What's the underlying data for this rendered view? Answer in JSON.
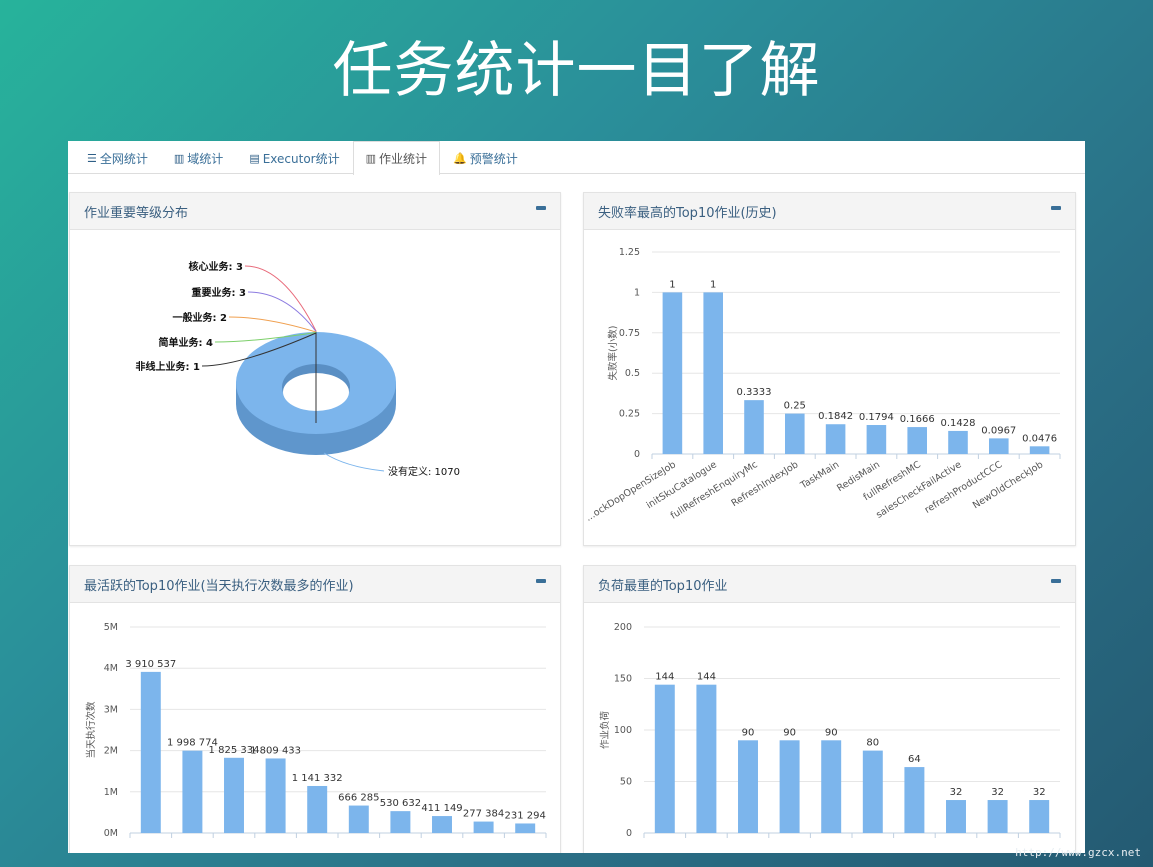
{
  "slide_title": "任务统计一目了解",
  "tabs": [
    {
      "icon": "list-icon",
      "glyph": "☰",
      "label": "全网统计",
      "active": false
    },
    {
      "icon": "bar-chart-icon",
      "glyph": "▥",
      "label": "域统计",
      "active": false
    },
    {
      "icon": "server-icon",
      "glyph": "▤",
      "label": "Executor统计",
      "active": false
    },
    {
      "icon": "column-chart-icon",
      "glyph": "▥",
      "label": "作业统计",
      "active": true
    },
    {
      "icon": "bell-icon",
      "glyph": "🔔",
      "label": "预警统计",
      "active": false
    }
  ],
  "panels": {
    "pie": {
      "title": "作业重要等级分布"
    },
    "fail": {
      "title": "失败率最高的Top10作业(历史)"
    },
    "active": {
      "title": "最活跃的Top10作业(当天执行次数最多的作业)"
    },
    "load": {
      "title": "负荷最重的Top10作业"
    }
  },
  "watermark": "http://www.gzcx.net",
  "colors": {
    "bar": "#7cb5ec",
    "accent": "#3a6f98",
    "tab_text": "#3a6f98"
  },
  "chart_data": [
    {
      "type": "pie",
      "style": "3d-donut",
      "slices": [
        {
          "label": "核心业务: 3",
          "value": 3,
          "line_color": "#e86a7a"
        },
        {
          "label": "重要业务: 3",
          "value": 3,
          "line_color": "#8c7be0"
        },
        {
          "label": "一般业务: 2",
          "value": 2,
          "line_color": "#f0a050"
        },
        {
          "label": "简单业务: 4",
          "value": 4,
          "line_color": "#7ccf6a"
        },
        {
          "label": "非线上业务: 1",
          "value": 1,
          "line_color": "#333333"
        },
        {
          "label": "没有定义: 1070",
          "value": 1070,
          "line_color": "#7cb5ec"
        }
      ]
    },
    {
      "type": "bar",
      "ylabel": "失败率(小数)",
      "ylim": [
        0,
        1.25
      ],
      "yticks": [
        "0",
        "0.25",
        "0.5",
        "0.75",
        "1",
        "1.25"
      ],
      "categories": [
        "...ockDopOpenSizeJob",
        "initSkuCatalogue",
        "fullRefreshEnquiryMc",
        "RefreshIndexJob",
        "TaskMain",
        "RedisMain",
        "fullRefreshMC",
        "salesCheckFailActive",
        "refreshProductCCC",
        "NewOldCheckJob"
      ],
      "values": [
        1,
        1,
        0.3333,
        0.25,
        0.1842,
        0.1794,
        0.1666,
        0.1428,
        0.0967,
        0.0476
      ],
      "labels": [
        "1",
        "1",
        "0.3333",
        "0.25",
        "0.1842",
        "0.1794",
        "0.1666",
        "0.1428",
        "0.0967",
        "0.0476"
      ]
    },
    {
      "type": "bar",
      "ylabel": "当天执行次数",
      "ylim": [
        0,
        5000000
      ],
      "yticks": [
        "0M",
        "1M",
        "2M",
        "3M",
        "4M",
        "5M"
      ],
      "values": [
        3910537,
        1998774,
        1825334,
        1809433,
        1141332,
        666285,
        530632,
        411149,
        277384,
        231294
      ],
      "labels": [
        "3 910 537",
        "1 998 774",
        "1 825 334",
        "1 809 433",
        "1 141 332",
        "666 285",
        "530 632",
        "411 149",
        "277 384",
        "231 294"
      ]
    },
    {
      "type": "bar",
      "ylabel": "作业负荷",
      "ylim": [
        0,
        200
      ],
      "yticks": [
        "0",
        "50",
        "100",
        "150",
        "200"
      ],
      "values": [
        144,
        144,
        90,
        90,
        90,
        80,
        64,
        32,
        32,
        32
      ],
      "labels": [
        "144",
        "144",
        "90",
        "90",
        "90",
        "80",
        "64",
        "32",
        "32",
        "32"
      ]
    }
  ]
}
